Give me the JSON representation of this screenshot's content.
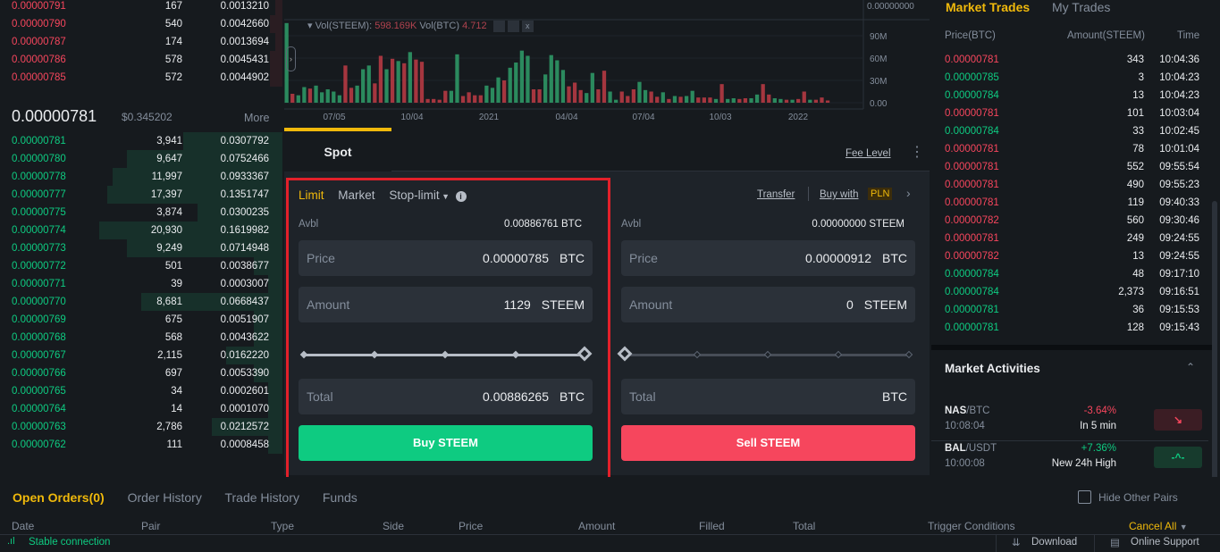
{
  "orderbook": {
    "asks": [
      [
        "0.00000791",
        "167",
        "0.0013210"
      ],
      [
        "0.00000790",
        "540",
        "0.0042660"
      ],
      [
        "0.00000787",
        "174",
        "0.0013694"
      ],
      [
        "0.00000786",
        "578",
        "0.0045431"
      ],
      [
        "0.00000785",
        "572",
        "0.0044902"
      ]
    ],
    "last_price": "0.00000781",
    "last_usd": "$0.345202",
    "more": "More",
    "bids": [
      [
        "0.00000781",
        "3,941",
        "0.0307792"
      ],
      [
        "0.00000780",
        "9,647",
        "0.0752466"
      ],
      [
        "0.00000778",
        "11,997",
        "0.0933367"
      ],
      [
        "0.00000777",
        "17,397",
        "0.1351747"
      ],
      [
        "0.00000775",
        "3,874",
        "0.0300235"
      ],
      [
        "0.00000774",
        "20,930",
        "0.1619982"
      ],
      [
        "0.00000773",
        "9,249",
        "0.0714948"
      ],
      [
        "0.00000772",
        "501",
        "0.0038677"
      ],
      [
        "0.00000771",
        "39",
        "0.0003007"
      ],
      [
        "0.00000770",
        "8,681",
        "0.0668437"
      ],
      [
        "0.00000769",
        "675",
        "0.0051907"
      ],
      [
        "0.00000768",
        "568",
        "0.0043622"
      ],
      [
        "0.00000767",
        "2,115",
        "0.0162220"
      ],
      [
        "0.00000766",
        "697",
        "0.0053390"
      ],
      [
        "0.00000765",
        "34",
        "0.0002601"
      ],
      [
        "0.00000764",
        "14",
        "0.0001070"
      ],
      [
        "0.00000763",
        "2,786",
        "0.0212572"
      ],
      [
        "0.00000762",
        "111",
        "0.0008458"
      ]
    ],
    "bid_depth": [
      0.35,
      0.55,
      0.6,
      0.62,
      0.3,
      0.65,
      0.55,
      0.1,
      0.05,
      0.5,
      0.1,
      0.1,
      0.2,
      0.1,
      0.05,
      0.05,
      0.25,
      0.05
    ]
  },
  "chart_data": {
    "type": "bar",
    "title": "",
    "legend": {
      "vol_steem_label": "Vol(STEEM):",
      "vol_steem": "598.169K",
      "vol_btc_label": "Vol(BTC)",
      "vol_btc": "4.712"
    },
    "price_tick": "0.00000000",
    "y_ticks": [
      "90M",
      "60M",
      "30M",
      "0.00"
    ],
    "y_tick_values": [
      90,
      60,
      30,
      0
    ],
    "ylim": [
      0,
      110
    ],
    "x_ticks": [
      "07/05",
      "10/04",
      "2021",
      "04/04",
      "07/04",
      "10/03",
      "2022"
    ],
    "values": [
      107,
      12,
      10,
      21,
      19,
      23,
      14,
      18,
      15,
      10,
      50,
      20,
      23,
      45,
      50,
      26,
      63,
      45,
      59,
      56,
      53,
      68,
      58,
      55,
      5,
      5,
      4,
      16,
      16,
      65,
      9,
      14,
      10,
      10,
      23,
      20,
      34,
      30,
      47,
      54,
      70,
      63,
      18,
      18,
      38,
      64,
      57,
      44,
      22,
      27,
      17,
      13,
      40,
      18,
      43,
      15,
      4,
      15,
      9,
      18,
      28,
      17,
      15,
      8,
      14,
      5,
      9,
      8,
      9,
      16,
      7,
      7,
      7,
      5,
      25,
      5,
      6,
      5,
      6,
      6,
      11,
      25,
      11,
      6,
      5,
      4,
      4,
      5,
      15,
      4,
      4,
      7,
      3
    ],
    "colors": "grggrgggggrrgggrrgrgrgrrrrrrggrrrrgggrggggrrggggrrrggrrggrrrggrrgrgrggrrrgrggrrggrrggrgrrgr"
  },
  "form": {
    "tab": "Spot",
    "fee_level": "Fee Level",
    "order_types": [
      "Limit",
      "Market",
      "Stop-limit"
    ],
    "transfer": "Transfer",
    "buy_with": "Buy with",
    "currency": "PLN",
    "buy": {
      "avbl_label": "Avbl",
      "avbl": "0.00886761 BTC",
      "price_label": "Price",
      "price": "0.00000785",
      "price_unit": "BTC",
      "amount_label": "Amount",
      "amount": "1129",
      "amount_unit": "STEEM",
      "total_label": "Total",
      "total": "0.00886265",
      "total_unit": "BTC",
      "button": "Buy STEEM",
      "slider_percent": 100
    },
    "sell": {
      "avbl_label": "Avbl",
      "avbl": "0.00000000 STEEM",
      "price_label": "Price",
      "price": "0.00000912",
      "price_unit": "BTC",
      "amount_label": "Amount",
      "amount": "0",
      "amount_unit": "STEEM",
      "total_label": "Total",
      "total": "",
      "total_unit": "BTC",
      "button": "Sell STEEM",
      "slider_percent": 0
    }
  },
  "trades": {
    "tabs": [
      "Market Trades",
      "My Trades"
    ],
    "headers": [
      "Price(BTC)",
      "Amount(STEEM)",
      "Time"
    ],
    "rows": [
      [
        "0.00000781",
        "343",
        "10:04:36",
        "r"
      ],
      [
        "0.00000785",
        "3",
        "10:04:23",
        "g"
      ],
      [
        "0.00000784",
        "13",
        "10:04:23",
        "g"
      ],
      [
        "0.00000781",
        "101",
        "10:03:04",
        "r"
      ],
      [
        "0.00000784",
        "33",
        "10:02:45",
        "g"
      ],
      [
        "0.00000781",
        "78",
        "10:01:04",
        "r"
      ],
      [
        "0.00000781",
        "552",
        "09:55:54",
        "r"
      ],
      [
        "0.00000781",
        "490",
        "09:55:23",
        "r"
      ],
      [
        "0.00000781",
        "119",
        "09:40:33",
        "r"
      ],
      [
        "0.00000782",
        "560",
        "09:30:46",
        "r"
      ],
      [
        "0.00000781",
        "249",
        "09:24:55",
        "r"
      ],
      [
        "0.00000782",
        "13",
        "09:24:55",
        "r"
      ],
      [
        "0.00000784",
        "48",
        "09:17:10",
        "g"
      ],
      [
        "0.00000784",
        "2,373",
        "09:16:51",
        "g"
      ],
      [
        "0.00000781",
        "36",
        "09:15:53",
        "g"
      ],
      [
        "0.00000781",
        "128",
        "09:15:43",
        "g"
      ]
    ]
  },
  "activities": {
    "title": "Market Activities",
    "items": [
      {
        "base": "NAS",
        "quote": "/BTC",
        "time": "10:08:04",
        "change": "-3.64%",
        "desc": "In 5 min"
      },
      {
        "base": "BAL",
        "quote": "/USDT",
        "time": "10:00:08",
        "change": "+7.36%",
        "desc": "New 24h High"
      }
    ]
  },
  "bottom": {
    "tabs": [
      "Open Orders(0)",
      "Order History",
      "Trade History",
      "Funds"
    ],
    "hide_other": "Hide Other Pairs",
    "columns": [
      "Date",
      "Pair",
      "Type",
      "Side",
      "Price",
      "Amount",
      "Filled",
      "Total",
      "Trigger Conditions"
    ],
    "cancel_all": "Cancel All"
  },
  "status": {
    "connection": "Stable connection",
    "download": "Download",
    "support": "Online Support"
  }
}
